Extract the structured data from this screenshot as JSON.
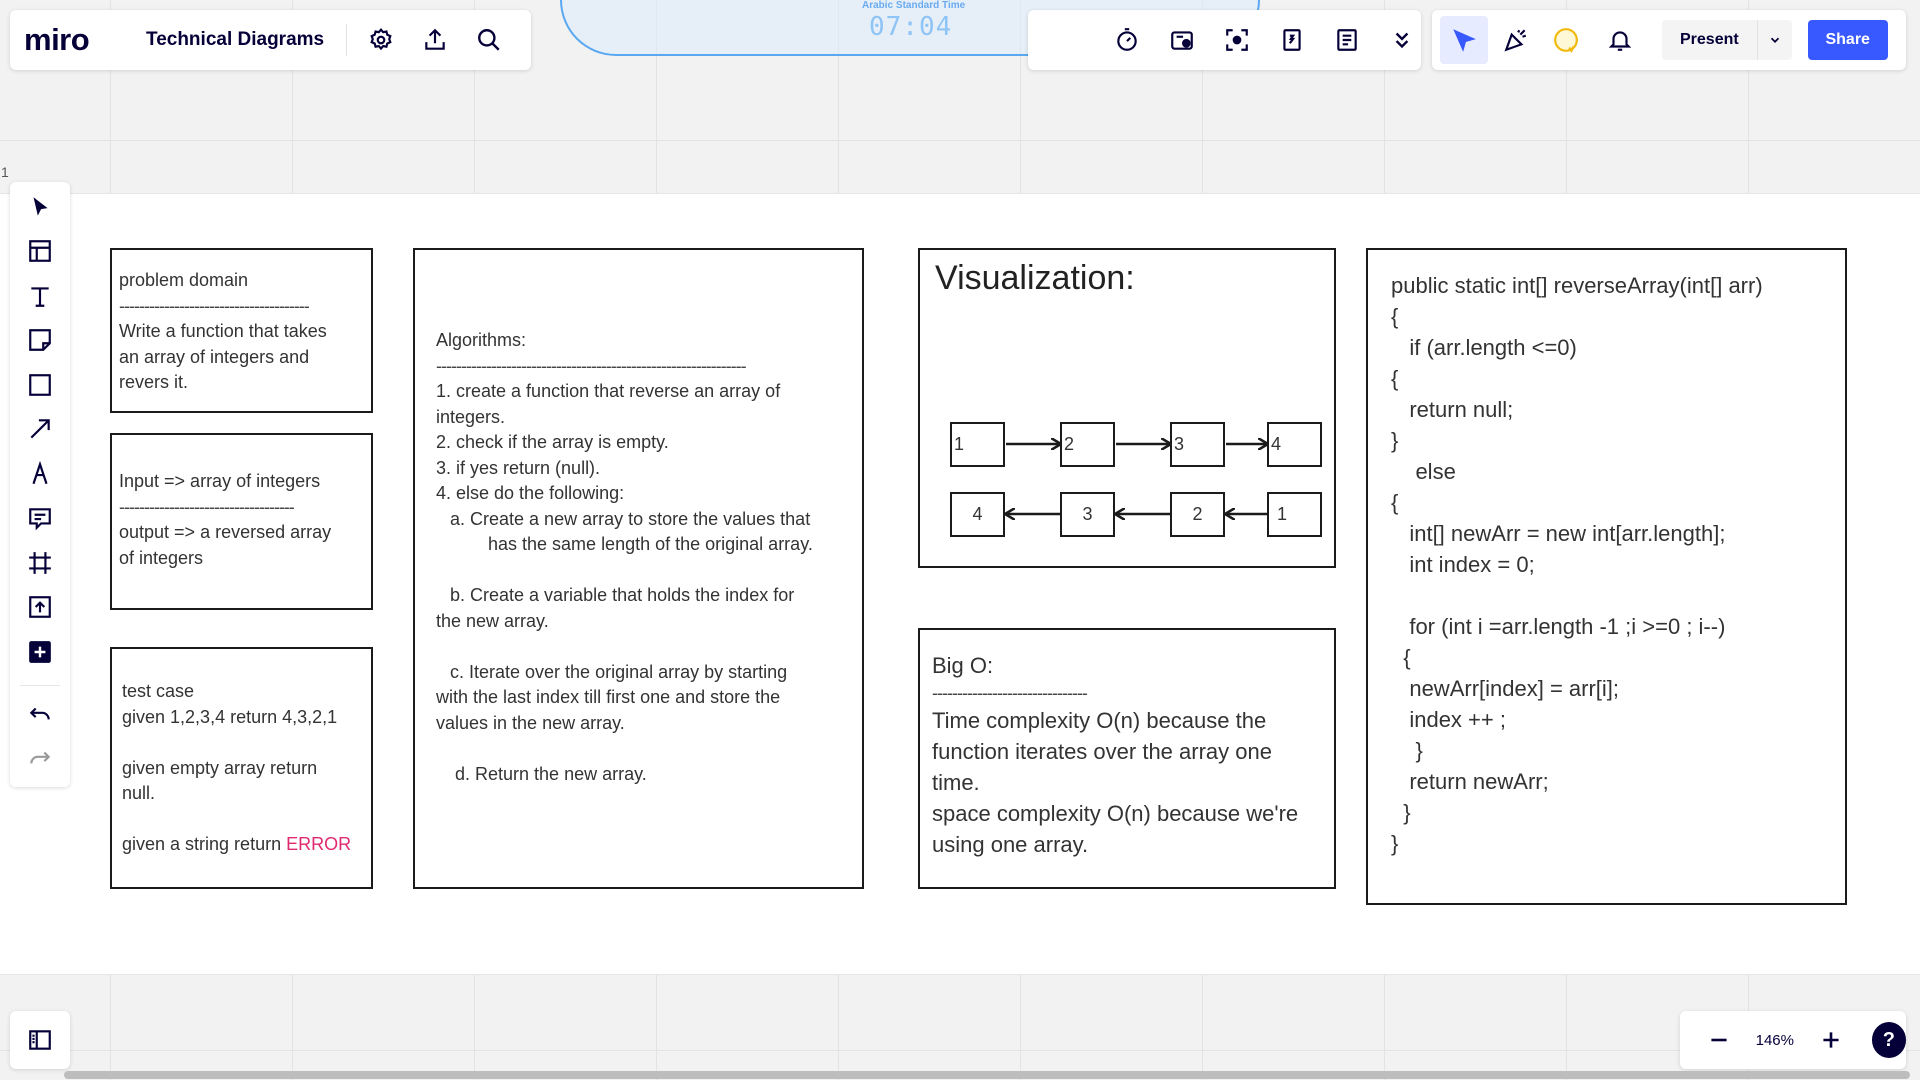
{
  "app": {
    "logo": "miro",
    "board_title": "Technical Diagrams"
  },
  "clock": {
    "label": "Arabic Standard Time",
    "time": "07:04"
  },
  "toolbar_right": {
    "present_label": "Present",
    "share_label": "Share"
  },
  "frame_label": "1",
  "zoom": {
    "value": "146%"
  },
  "cards": {
    "problem": {
      "title": "problem domain",
      "divider": "--------------------------------------",
      "body": [
        "Write a function that takes",
        "an array of integers and",
        "revers it."
      ]
    },
    "io": {
      "input": "Input => array of integers",
      "divider": "-----------------------------------",
      "output": [
        "output => a reversed array",
        "of integers"
      ]
    },
    "tests": {
      "title": "test case",
      "case1": "given 1,2,3,4 return 4,3,2,1",
      "case2": [
        "given empty array return",
        "null."
      ],
      "case3_prefix": "given a string return ",
      "case3_error": "ERROR"
    },
    "algorithm": {
      "title": "Algorithms:",
      "divider": "--------------------------------------------------------------",
      "steps": [
        "1. create a function that reverse an array of",
        "integers.",
        "2. check if the array is empty.",
        "3. if yes return (null).",
        "4. else do the following:"
      ],
      "a1": "a. Create a new array to store the values that",
      "a2": "has the same length of the original array.",
      "b1": "b. Create a variable that holds the index for",
      "b2": "the new array.",
      "c": [
        "c. Iterate over the original array by starting",
        "with the last index till first one and store the",
        "values in the new array."
      ],
      "d": "d. Return the new array."
    },
    "visualization": {
      "title": "Visualization:",
      "forward": [
        "1",
        "2",
        "3",
        "4"
      ],
      "reversed": [
        "4",
        "3",
        "2",
        "1"
      ]
    },
    "bigo": {
      "title": "Big O:",
      "divider": "-------------------------------",
      "lines": [
        "Time complexity O(n) because the",
        "function iterates over the array one",
        "time.",
        "space complexity O(n) because we're",
        "using one array."
      ]
    },
    "code": {
      "lines": [
        "public static int[] reverseArray(int[] arr)",
        "{",
        "   if (arr.length <=0)",
        "{",
        "   return null;",
        "}",
        "    else",
        "{",
        "   int[] newArr = new int[arr.length];",
        "   int index = 0;",
        "",
        "   for (int i =arr.length -1 ;i >=0 ; i--)",
        "  {",
        "   newArr[index] = arr[i];",
        "   index ++ ;",
        "    }",
        "   return newArr;",
        "  }",
        "}"
      ]
    }
  },
  "colors": {
    "accent": "#3859ff",
    "error": "#e0296f",
    "ink": "#050038"
  }
}
